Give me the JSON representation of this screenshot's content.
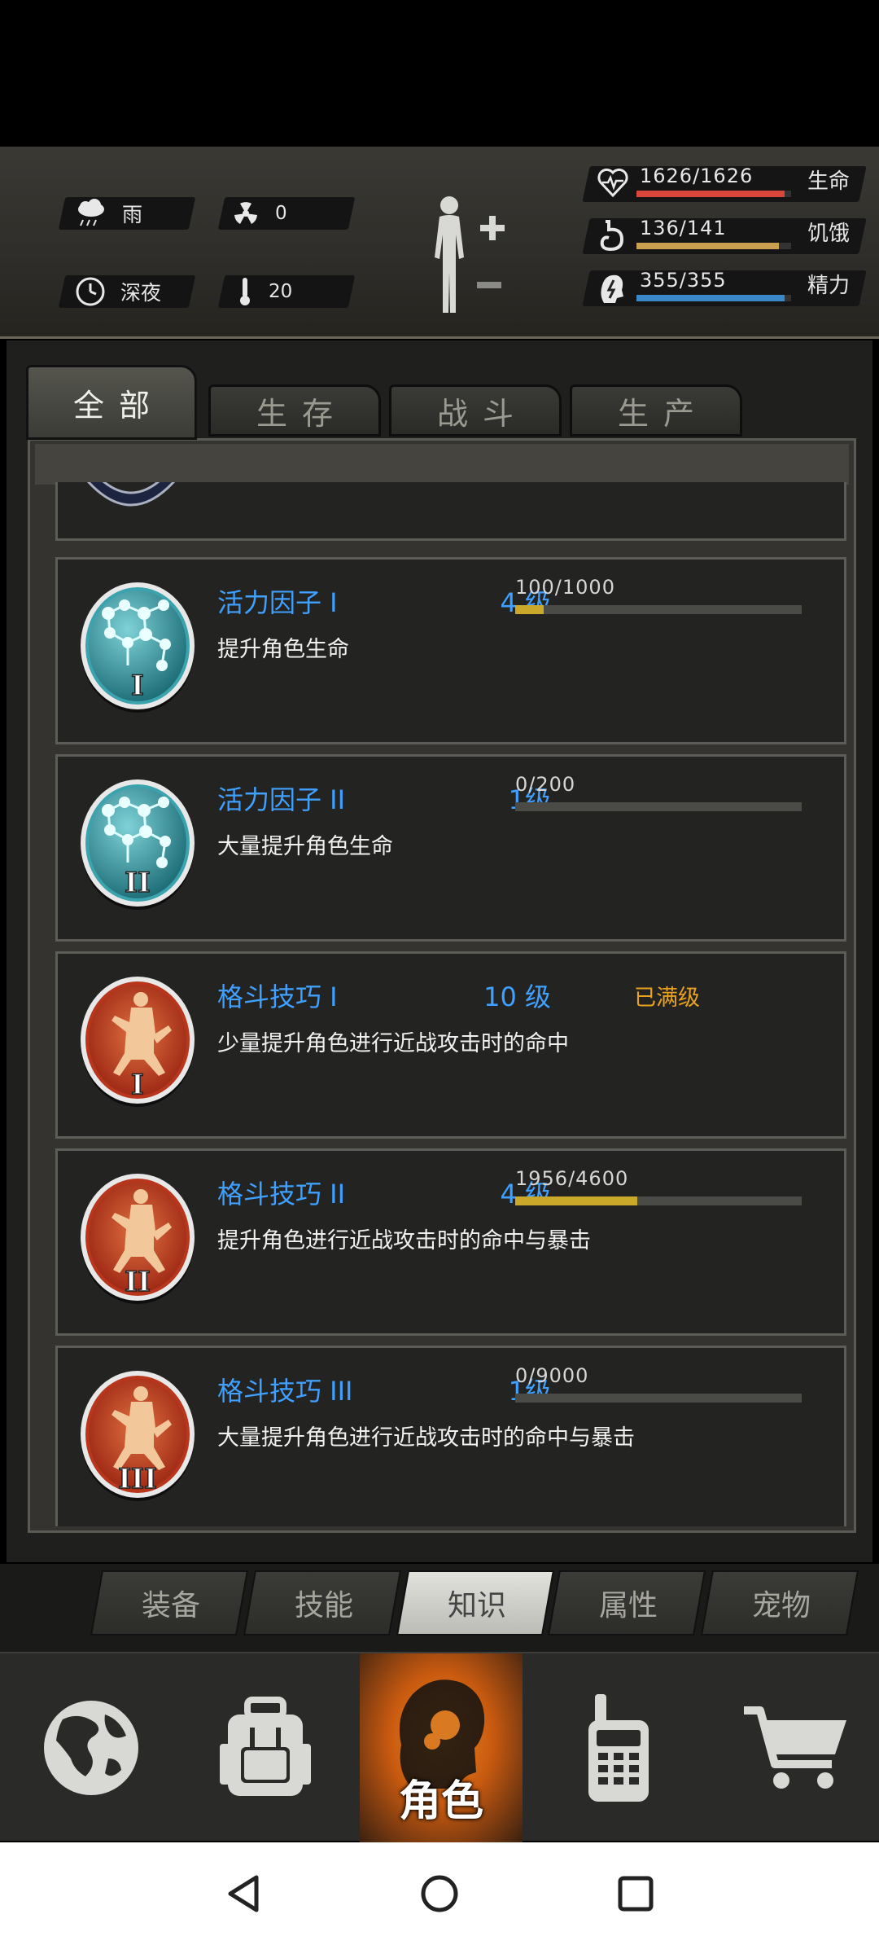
{
  "weather": {
    "label": "雨"
  },
  "radiation": {
    "value": "0"
  },
  "time_of_day": {
    "label": "深夜"
  },
  "temperature": {
    "value": "20"
  },
  "stats": [
    {
      "value": "1626/1626",
      "name": "生命",
      "fraction": 1.0,
      "color": "#d9473a",
      "icon": "heart-pulse-icon"
    },
    {
      "value": "136/141",
      "name": "饥饿",
      "fraction": 0.96,
      "color": "#c9a050",
      "icon": "stomach-icon"
    },
    {
      "value": "355/355",
      "name": "精力",
      "fraction": 1.0,
      "color": "#3b88c8",
      "icon": "energy-head-icon"
    }
  ],
  "category_tabs": [
    {
      "label": "全部",
      "active": true
    },
    {
      "label": "生存",
      "active": false
    },
    {
      "label": "战斗",
      "active": false
    },
    {
      "label": "生产",
      "active": false
    }
  ],
  "skills": [
    {
      "title": "活力因子 I",
      "level": "4 级",
      "desc": "提升角色生命",
      "progress": "100/1000",
      "fraction": 0.1,
      "rank": "I",
      "icon": "molecule-icon",
      "maxed": false
    },
    {
      "title": "活力因子 II",
      "level": "1级",
      "desc": "大量提升角色生命",
      "progress": "0/200",
      "fraction": 0.0,
      "rank": "II",
      "icon": "molecule-icon",
      "maxed": false
    },
    {
      "title": "格斗技巧 I",
      "level": "10 级",
      "desc": "少量提升角色进行近战攻击时的命中",
      "progress": "",
      "fraction": 1.0,
      "rank": "I",
      "icon": "martial-arts-icon",
      "maxed": true,
      "maxed_label": "已满级"
    },
    {
      "title": "格斗技巧 II",
      "level": "4 级",
      "desc": "提升角色进行近战攻击时的命中与暴击",
      "progress": "1956/4600",
      "fraction": 0.425,
      "rank": "II",
      "icon": "martial-arts-icon",
      "maxed": false
    },
    {
      "title": "格斗技巧 III",
      "level": "1级",
      "desc": "大量提升角色进行近战攻击时的命中与暴击",
      "progress": "0/9000",
      "fraction": 0.0,
      "rank": "III",
      "icon": "martial-arts-icon",
      "maxed": false
    }
  ],
  "sub_tabs": [
    {
      "label": "装备",
      "active": false
    },
    {
      "label": "技能",
      "active": false
    },
    {
      "label": "知识",
      "active": true
    },
    {
      "label": "属性",
      "active": false
    },
    {
      "label": "宠物",
      "active": false
    }
  ],
  "bottom_nav": [
    {
      "icon": "globe-icon",
      "label": ""
    },
    {
      "icon": "backpack-icon",
      "label": ""
    },
    {
      "icon": "character-head-icon",
      "label": "角色",
      "active": true
    },
    {
      "icon": "walkie-talkie-icon",
      "label": ""
    },
    {
      "icon": "shopping-cart-icon",
      "label": ""
    }
  ]
}
